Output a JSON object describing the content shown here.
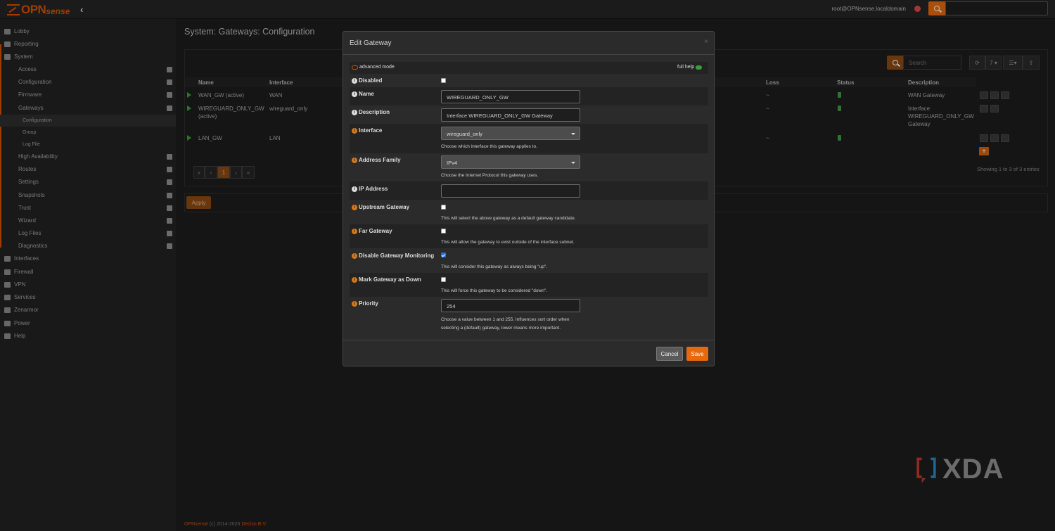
{
  "header": {
    "logo_opn": "OPN",
    "logo_sense": "sense",
    "user": "root@OPNsense.localdomain"
  },
  "sidebar": {
    "items": [
      {
        "label": "Lobby",
        "icon": "laptop-icon"
      },
      {
        "label": "Reporting",
        "icon": "chart-icon"
      },
      {
        "label": "System",
        "icon": "server-icon"
      },
      {
        "label": "Access",
        "icon": "users-icon"
      },
      {
        "label": "Configuration",
        "icon": "history-icon"
      },
      {
        "label": "Firmware",
        "icon": "document-icon"
      },
      {
        "label": "Gateways",
        "icon": "location-arrow-icon"
      },
      {
        "label": "Configuration",
        "icon": ""
      },
      {
        "label": "Group",
        "icon": ""
      },
      {
        "label": "Log File",
        "icon": ""
      },
      {
        "label": "High Availability",
        "icon": "refresh-icon"
      },
      {
        "label": "Routes",
        "icon": "signpost-icon"
      },
      {
        "label": "Settings",
        "icon": "cogs-icon"
      },
      {
        "label": "Snapshots",
        "icon": "hdd-icon"
      },
      {
        "label": "Trust",
        "icon": "certificate-icon"
      },
      {
        "label": "Wizard",
        "icon": "magic-icon"
      },
      {
        "label": "Log Files",
        "icon": "eye-icon"
      },
      {
        "label": "Diagnostics",
        "icon": "medkit-icon"
      },
      {
        "label": "Interfaces",
        "icon": "sitemap-icon"
      },
      {
        "label": "Firewall",
        "icon": "fire-icon"
      },
      {
        "label": "VPN",
        "icon": "globe-icon"
      },
      {
        "label": "Services",
        "icon": "cog-icon"
      },
      {
        "label": "Zenarmor",
        "icon": "shield-icon"
      },
      {
        "label": "Power",
        "icon": "plug-icon"
      },
      {
        "label": "Help",
        "icon": "help-icon"
      }
    ]
  },
  "page": {
    "title": "System: Gateways: Configuration",
    "search_placeholder": "Search",
    "page_size": "7",
    "apply_label": "Apply",
    "showing": "Showing 1 to 3 of 3 entries",
    "pager": [
      "«",
      "‹",
      "1",
      "›",
      "»"
    ]
  },
  "table": {
    "columns": [
      "Name",
      "Interface",
      "Loss",
      "Status",
      "Description"
    ],
    "rows": [
      {
        "name": "WAN_GW (active)",
        "interface": "WAN",
        "loss": "~",
        "description": "WAN Gateway"
      },
      {
        "name": "WIREGUARD_ONLY_GW (active)",
        "interface": "wireguard_only",
        "loss": "~",
        "description": "Interface WIREGUARD_ONLY_GW Gateway"
      },
      {
        "name": "LAN_GW",
        "interface": "LAN",
        "loss": "~",
        "description": ""
      }
    ]
  },
  "modal": {
    "title": "Edit Gateway",
    "advanced_mode": "advanced mode",
    "full_help": "full help",
    "fields": {
      "disabled": {
        "label": "Disabled",
        "checked": false
      },
      "name": {
        "label": "Name",
        "value": "WIREGUARD_ONLY_GW"
      },
      "description": {
        "label": "Description",
        "value": "Interface WIREGUARD_ONLY_GW Gateway"
      },
      "interface": {
        "label": "Interface",
        "value": "wireguard_only",
        "help": "Choose which interface this gateway applies to."
      },
      "address_family": {
        "label": "Address Family",
        "value": "IPv4",
        "help": "Choose the Internet Protocol this gateway uses."
      },
      "ip_address": {
        "label": "IP Address",
        "value": ""
      },
      "upstream": {
        "label": "Upstream Gateway",
        "checked": false,
        "help": "This will select the above gateway as a default gateway candidate."
      },
      "far": {
        "label": "Far Gateway",
        "checked": false,
        "help": "This will allow the gateway to exist outside of the interface subnet."
      },
      "monitoring": {
        "label": "Disable Gateway Monitoring",
        "checked": true,
        "help": "This will consider this gateway as always being \"up\"."
      },
      "down": {
        "label": "Mark Gateway as Down",
        "checked": false,
        "help": "This will force this gateway to be considered \"down\"."
      },
      "priority": {
        "label": "Priority",
        "value": "254",
        "help": "Choose a value between 1 and 255. Influences sort order when selecting a (default) gateway, lower means more important."
      }
    },
    "cancel_label": "Cancel",
    "save_label": "Save"
  },
  "footer": {
    "brand": "OPNsense",
    "copy": "(c) 2014-2025",
    "company": "Deciso B.V."
  },
  "watermark": "XDA",
  "colors": {
    "accent": "#e5690d",
    "status_green": "#3b9c3b",
    "status_red": "#e24444"
  }
}
